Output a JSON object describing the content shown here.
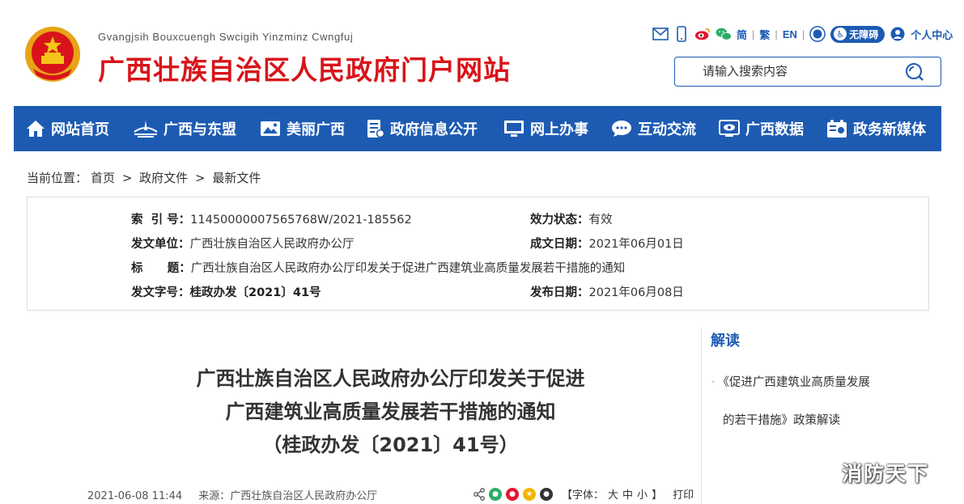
{
  "header": {
    "site_subtitle": "Gvangjsih Bouxcuengh Swcigih Yinzminz Cwngfuj",
    "site_title": "广西壮族自治区人民政府门户网站",
    "toolbar": {
      "simplified": "简",
      "traditional": "繁",
      "english": "EN",
      "accessibility": "无障碍",
      "personal_center": "个人中心",
      "sep": "|"
    },
    "search": {
      "placeholder": "请输入搜索内容"
    }
  },
  "nav": {
    "items": [
      {
        "label": "网站首页",
        "icon": "home-icon"
      },
      {
        "label": "广西与东盟",
        "icon": "bridge-icon"
      },
      {
        "label": "美丽广西",
        "icon": "picture-icon"
      },
      {
        "label": "政府信息公开",
        "icon": "document-icon"
      },
      {
        "label": "网上办事",
        "icon": "monitor-icon"
      },
      {
        "label": "互动交流",
        "icon": "chat-icon"
      },
      {
        "label": "广西数据",
        "icon": "eye-icon"
      },
      {
        "label": "政务新媒体",
        "icon": "media-icon"
      }
    ]
  },
  "breadcrumb": {
    "prefix": "当前位置：",
    "items": [
      "首页",
      "政府文件",
      "最新文件"
    ],
    "sep": ">"
  },
  "info": {
    "index_key": "索  引 号：",
    "index_val": "11450000007565768W/2021-185562",
    "status_key": "效力状态：",
    "status_val": "有效",
    "issuer_key": "发文单位：",
    "issuer_val": "广西壮族自治区人民政府办公厅",
    "date_made_key": "成文日期：",
    "date_made_val": "2021年06月01日",
    "title_key": "标      题：",
    "title_val": "广西壮族自治区人民政府办公厅印发关于促进广西建筑业高质量发展若干措施的通知",
    "doc_no_key": "发文字号：",
    "doc_no_val": "桂政办发〔2021〕41号",
    "pub_date_key": "发布日期：",
    "pub_date_val": "2021年06月08日"
  },
  "article": {
    "title_line1": "广西壮族自治区人民政府办公厅印发关于促进",
    "title_line2": "广西建筑业高质量发展若干措施的通知",
    "title_line3": "（桂政办发〔2021〕41号）",
    "datetime": "2021-06-08 11:44",
    "source": "来源：广西壮族自治区人民政府办公厅",
    "font_label": "【字体：",
    "font_large": "大",
    "font_medium": "中",
    "font_small": "小",
    "font_close": "】",
    "print": "打印"
  },
  "sidebar": {
    "title": "解读",
    "item_line1": "《促进广西建筑业高质量发展",
    "item_line2": "的若干措施》政策解读"
  },
  "watermark": "消防天下",
  "colors": {
    "brand_blue": "#1d5bb3",
    "title_red": "#d8141a"
  }
}
